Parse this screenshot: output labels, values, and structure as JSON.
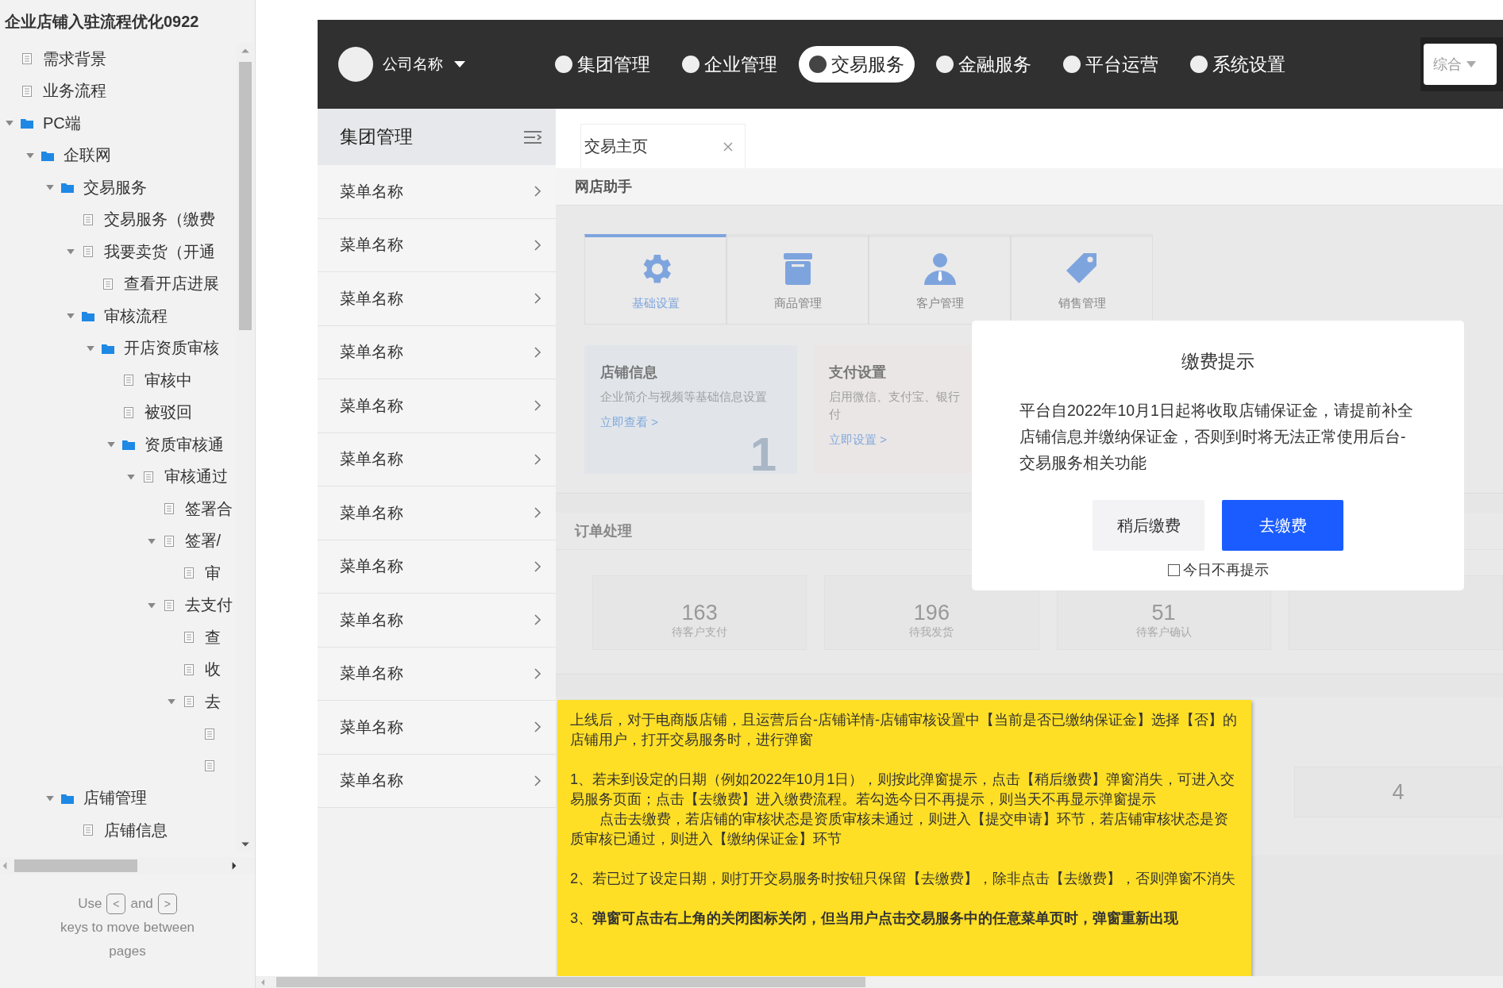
{
  "sidebar": {
    "title": "企业店铺入驻流程优化0922",
    "tree": [
      {
        "label": "需求背景",
        "kind": "page"
      },
      {
        "label": "业务流程",
        "kind": "page"
      },
      {
        "label": "PC端",
        "kind": "folder",
        "expanded": true,
        "children": [
          {
            "label": "企联网",
            "kind": "folder",
            "expanded": true,
            "children": [
              {
                "label": "交易服务",
                "kind": "folder",
                "expanded": true,
                "children": [
                  {
                    "label": "交易服务（缴费",
                    "kind": "page"
                  },
                  {
                    "label": "我要卖货（开通",
                    "kind": "page",
                    "expanded": true,
                    "children": [
                      {
                        "label": "查看开店进展",
                        "kind": "page"
                      }
                    ]
                  },
                  {
                    "label": "审核流程",
                    "kind": "folder",
                    "expanded": true,
                    "children": [
                      {
                        "label": "开店资质审核",
                        "kind": "folder",
                        "expanded": true,
                        "children": [
                          {
                            "label": "审核中",
                            "kind": "page"
                          },
                          {
                            "label": "被驳回",
                            "kind": "page"
                          },
                          {
                            "label": "资质审核通",
                            "kind": "folder",
                            "expanded": true,
                            "children": [
                              {
                                "label": "审核通过",
                                "kind": "page",
                                "expanded": true,
                                "children": [
                                  {
                                    "label": "签署合",
                                    "kind": "page"
                                  },
                                  {
                                    "label": "签署/",
                                    "kind": "page",
                                    "expanded": true,
                                    "children": [
                                      {
                                        "label": "审",
                                        "kind": "page"
                                      }
                                    ]
                                  },
                                  {
                                    "label": "去支付",
                                    "kind": "page",
                                    "expanded": true,
                                    "children": [
                                      {
                                        "label": "查",
                                        "kind": "page"
                                      },
                                      {
                                        "label": "收",
                                        "kind": "page"
                                      },
                                      {
                                        "label": "去",
                                        "kind": "page",
                                        "expanded": true,
                                        "children": [
                                          {
                                            "kind": "page"
                                          },
                                          {
                                            "kind": "page"
                                          }
                                        ]
                                      }
                                    ]
                                  }
                                ]
                              }
                            ]
                          }
                        ]
                      }
                    ]
                  }
                ]
              },
              {
                "label": "店铺管理",
                "kind": "folder",
                "expanded": true,
                "children": [
                  {
                    "label": "店铺信息",
                    "kind": "page"
                  }
                ]
              }
            ]
          }
        ]
      }
    ],
    "footer": {
      "use": "Use",
      "prev_key": "<",
      "and": "and",
      "next_key": ">",
      "rest": "keys to move between pages"
    }
  },
  "topbar": {
    "company": "公司名称",
    "nav": [
      {
        "label": "集团管理",
        "selected": false
      },
      {
        "label": "企业管理",
        "selected": false
      },
      {
        "label": "交易服务",
        "selected": true
      },
      {
        "label": "金融服务",
        "selected": false
      },
      {
        "label": "平台运营",
        "selected": false
      },
      {
        "label": "系统设置",
        "selected": false
      }
    ],
    "filter": "综合"
  },
  "menu": {
    "title": "集团管理",
    "items": [
      "菜单名称",
      "菜单名称",
      "菜单名称",
      "菜单名称",
      "菜单名称",
      "菜单名称",
      "菜单名称",
      "菜单名称",
      "菜单名称",
      "菜单名称",
      "菜单名称",
      "菜单名称"
    ]
  },
  "tabs": [
    {
      "label": "交易主页",
      "selected": true
    }
  ],
  "assistant": {
    "title": "网店助手",
    "icon_tabs": [
      {
        "label": "基础设置",
        "selected": true
      },
      {
        "label": "商品管理",
        "selected": false
      },
      {
        "label": "客户管理",
        "selected": false
      },
      {
        "label": "销售管理",
        "selected": false
      }
    ],
    "cards": [
      {
        "title": "店铺信息",
        "description": [
          "企业简介与视频等基础信息设置"
        ],
        "link": "立即查看 >",
        "number": "1"
      },
      {
        "title": "支付设置",
        "description": [
          "启用微信、支付宝、银行",
          "付"
        ],
        "link": "立即设置 >"
      }
    ]
  },
  "orders": {
    "title": "订单处理",
    "stats": [
      {
        "value": "163",
        "label": "待客户支付"
      },
      {
        "value": "196",
        "label": "待我发货"
      },
      {
        "value": "51",
        "label": "待客户确认"
      }
    ]
  },
  "section_3": {
    "stats": [
      {
        "value": "4"
      }
    ]
  },
  "dialog": {
    "title": "缴费提示",
    "message": "平台自2022年10月1日起将收取店铺保证金，请提前补全店铺信息并缴纳保证金，否则到时将无法正常使用后台-交易服务相关功能",
    "buttons": [
      {
        "label": "稍后缴费",
        "kind": "secondary"
      },
      {
        "label": "去缴费",
        "kind": "primary"
      }
    ],
    "checkbox": {
      "label": "今日不再提示",
      "checked": false
    }
  },
  "note": {
    "paragraphs": [
      {
        "text": "上线后，对于电商版店铺，且运营后台-店铺详情-店铺审核设置中【当前是否已缴纳保证金】选择【否】的店铺用户，打开交易服务时，进行弹窗",
        "kind": "normal"
      },
      {
        "text": "1、若未到设定的日期（例如2022年10月1日），则按此弹窗提示，点击【稍后缴费】弹窗消失，可进入交易服务页面；点击【去缴费】进入缴费流程。若勾选今日不再提示，则当天不再显示弹窗提示",
        "kind": "normal"
      },
      {
        "text": "点击去缴费，若店铺的审核状态是资质审核未通过，则进入【提交申请】环节，若店铺审核状态是资质审核已通过，则进入【缴纳保证金】环节",
        "kind": "indented"
      },
      {
        "text": "2、若已过了设定日期，则打开交易服务时按钮只保留【去缴费】，除非点击【去缴费】，否则弹窗不消失",
        "kind": "normal"
      },
      {
        "text": "3、**弹窗可点击右上角的关闭图标关闭，但当用户点击交易服务中的任意菜单页时，弹窗重新出现**",
        "kind": "normal"
      }
    ]
  }
}
